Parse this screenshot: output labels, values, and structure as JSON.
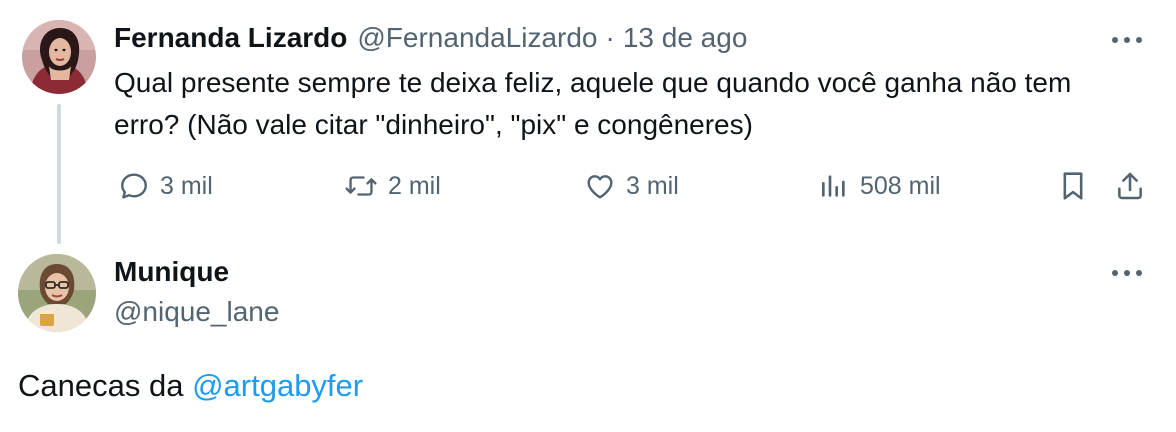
{
  "parent_tweet": {
    "avatar_icon": "profile-photo-avatar",
    "name": "Fernanda Lizardo",
    "handle": "@FernandaLizardo",
    "separator": "·",
    "time": "13 de ago",
    "more_icon": "more-horizontal-icon",
    "text": "Qual presente sempre te deixa feliz, aquele que quando você ganha não tem erro? (Não vale citar \"dinheiro\", \"pix\" e congêneres)",
    "actions": {
      "reply": {
        "icon": "reply-icon",
        "count": "3 mil"
      },
      "retweet": {
        "icon": "retweet-icon",
        "count": "2 mil"
      },
      "like": {
        "icon": "heart-icon",
        "count": "3 mil"
      },
      "views": {
        "icon": "views-icon",
        "count": "508 mil"
      },
      "bookmark": {
        "icon": "bookmark-icon"
      },
      "share": {
        "icon": "share-icon"
      }
    }
  },
  "reply_tweet": {
    "avatar_icon": "profile-photo-avatar",
    "name": "Munique",
    "handle": "@nique_lane",
    "more_icon": "more-horizontal-icon",
    "text_prefix": "Canecas da ",
    "mention": "@artgabyfer"
  },
  "colors": {
    "text_primary": "#0f1419",
    "text_secondary": "#536471",
    "link": "#1d9bf0",
    "thread_line": "#cfd9de"
  }
}
